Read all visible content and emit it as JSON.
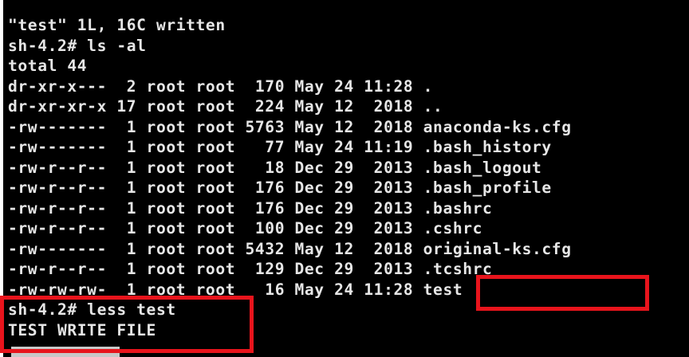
{
  "terminal": {
    "lines": [
      "\"test\" 1L, 16C written",
      "sh-4.2# ls -al",
      "total 44",
      "dr-xr-x---  2 root root  170 May 24 11:28 .",
      "dr-xr-xr-x 17 root root  224 May 12  2018 ..",
      "-rw-------  1 root root 5763 May 12  2018 anaconda-ks.cfg",
      "-rw-------  1 root root   77 May 24 11:19 .bash_history",
      "-rw-r--r--  1 root root   18 Dec 29  2013 .bash_logout",
      "-rw-r--r--  1 root root  176 Dec 29  2013 .bash_profile",
      "-rw-r--r--  1 root root  176 Dec 29  2013 .bashrc",
      "-rw-r--r--  1 root root  100 Dec 29  2013 .cshrc",
      "-rw-------  1 root root 5432 May 12  2018 original-ks.cfg",
      "-rw-r--r--  1 root root  129 Dec 29  2013 .tcshrc",
      "-rw-rw-rw-  1 root root   16 May 24 11:28 test",
      "sh-4.2# less test",
      "TEST WRITE FILE"
    ]
  },
  "colors": {
    "background": "#000000",
    "text": "#e6e6e6",
    "highlight": "#e8141c",
    "pager_status": "#c8c8c8"
  }
}
